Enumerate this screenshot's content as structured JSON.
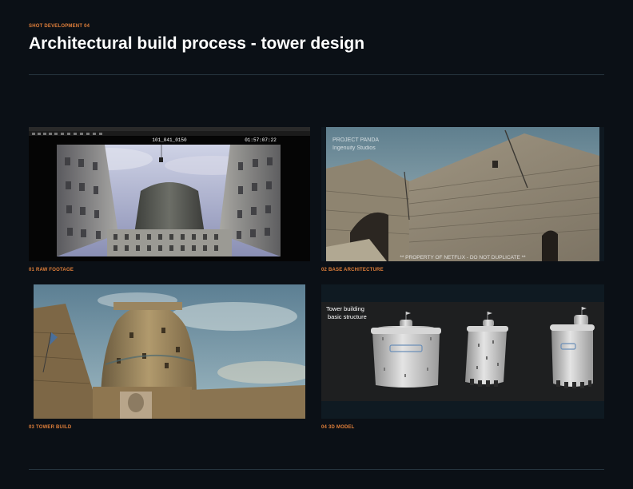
{
  "header": {
    "kicker": "SHOT DEVELOPMENT 04",
    "title": "Architectural build process - tower design"
  },
  "panels": [
    {
      "caption": "01 RAW FOOTAGE",
      "shot_id": "101_041_0150",
      "timecode": "01:57:07:22",
      "watermark_top": "",
      "watermark_bottom": ""
    },
    {
      "caption": "02 BASE ARCHITECTURE",
      "studio_line1": "PROJECT PANDA",
      "studio_line2": "Ingenuity Studios",
      "watermark_bottom": "** PROPERTY OF NETFLIX - DO NOT DUPLICATE **"
    },
    {
      "caption": "03 TOWER BUILD"
    },
    {
      "caption": "04 3D MODEL",
      "model_label_line1": "Tower building",
      "model_label_line2": "basic structure"
    }
  ],
  "colors": {
    "background": "#0b1016",
    "accent": "#e07f3a",
    "rule": "#27353f"
  }
}
